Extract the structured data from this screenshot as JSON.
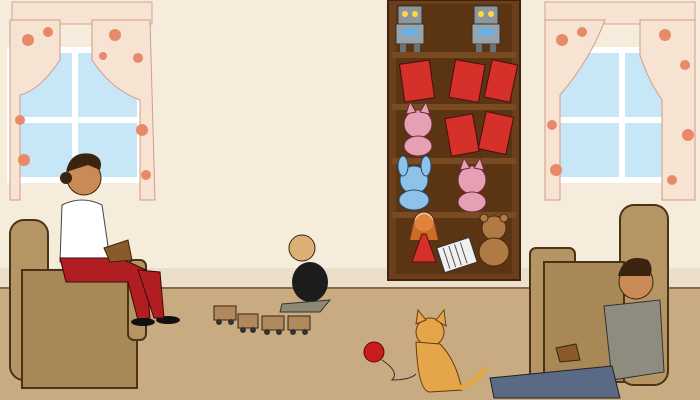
{
  "scene": {
    "type": "cartoon-game-scene",
    "colors": {
      "wall": "#f5ecdc",
      "floor": "#c9ab82",
      "shelf": "#6b3f1a",
      "curtain": "#f6e3d2",
      "armchair": "#b59564",
      "window_sky": "#c7e7f6",
      "book_red": "#d6302b",
      "cat_orange": "#e4a648",
      "yarn_red": "#c91d1d"
    },
    "objects": {
      "left_window": "window",
      "right_window": "window",
      "bookshelf": "bookshelf",
      "robots": [
        "robot-toy",
        "robot-toy"
      ],
      "books_top": [
        "book",
        "book",
        "book"
      ],
      "books_mid": [
        "book",
        "book"
      ],
      "plush": [
        "pink-cat-plush",
        "blue-bunny-plush",
        "pink-cat-plush",
        "teddy-bear"
      ],
      "doll": "red-dress-doll",
      "accordion": "accordion",
      "train": "toy-train",
      "yarn": "yarn-ball",
      "cat": "orange-cat",
      "mother": "woman-reading",
      "baby": "baby-sitting",
      "father": "man-reclining"
    }
  }
}
